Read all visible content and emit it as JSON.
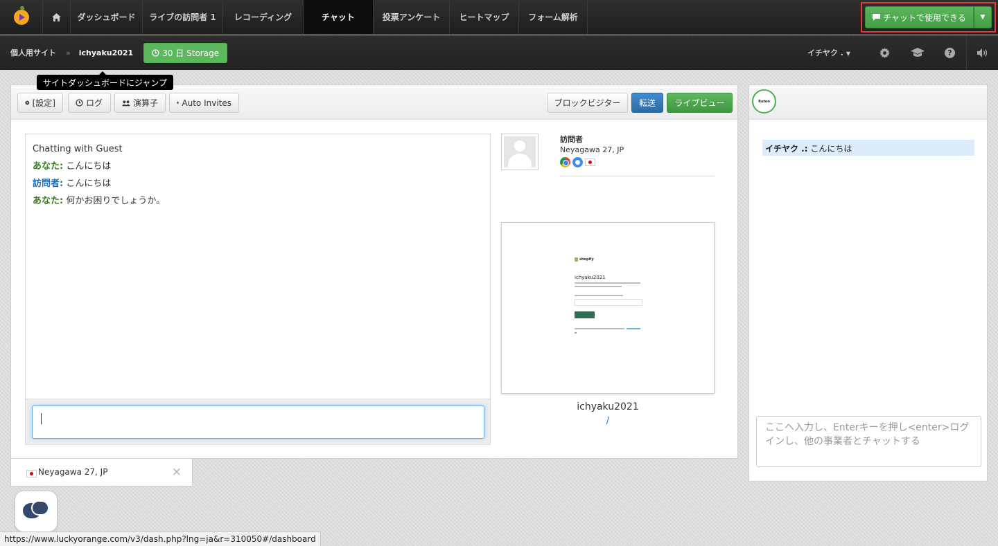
{
  "topnav": {
    "items": [
      {
        "label": "ダッシュボード"
      },
      {
        "label": "ライブの訪問者 1"
      },
      {
        "label": "レコーディング"
      },
      {
        "label": "チャット"
      },
      {
        "label": "投票アンケート"
      },
      {
        "label": "ヒートマップ"
      },
      {
        "label": "フォーム解析"
      }
    ],
    "active_index": 3,
    "cta_label": "チャットで使用できる"
  },
  "subbar": {
    "site": "個人用サイト",
    "separator": "»",
    "current": "ichyaku2021",
    "storage_label": "30 日 Storage",
    "user_menu": "イチヤク ."
  },
  "tooltip": "サイトダッシュボードにジャンプ",
  "toolbar": {
    "settings": "[設定]",
    "log": "ログ",
    "operators": "演算子",
    "auto_invites": "Auto Invites",
    "block_visitor": "ブロックビジター",
    "transfer": "転送",
    "live_view": "ライブビュー"
  },
  "chat": {
    "header": "Chatting with Guest",
    "messages": [
      {
        "speaker": "あなた:",
        "text": "こんにちは"
      },
      {
        "speaker": "訪問者:",
        "text": "こんにちは"
      },
      {
        "speaker": "あなた:",
        "text": "何かお困りでしょうか。"
      }
    ],
    "input_value": ""
  },
  "visitor": {
    "name": "訪問者",
    "location": "Neyagawa 27, JP",
    "browser": "chrome-icon",
    "os": "apple-icon",
    "country": "jp-flag"
  },
  "preview": {
    "brand": "shopify",
    "title": "ichyaku2021"
  },
  "site": {
    "name": "ichyaku2021",
    "path": "/"
  },
  "visitor_tab": {
    "label": "Neyagawa 27, JP",
    "close": "×"
  },
  "operator_chat": {
    "logo_text": "Ruton",
    "message_sender": "イチヤク .:",
    "message_text": " こんにちは",
    "placeholder": "ここへ入力し、Enterキーを押し<enter>ログインし、他の事業者とチャットする"
  },
  "statusbar": "https://www.luckyorange.com/v3/dash.php?lng=ja&r=310050#/dashboard",
  "colors": {
    "accent_green": "#5cb85c",
    "accent_blue": "#428bca",
    "highlight_red": "#e33b3b"
  }
}
